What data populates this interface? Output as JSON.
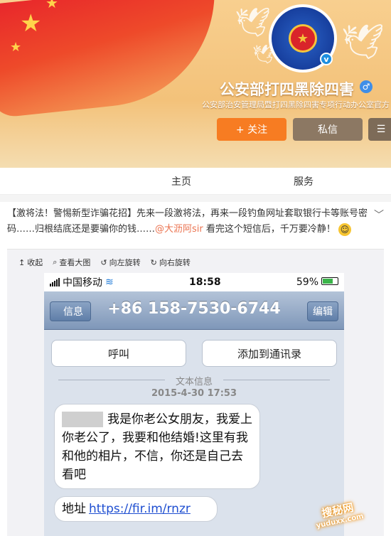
{
  "profile": {
    "name": "公安部打四黑除四害",
    "description": "公安部治安管理局暨打四黑除四害专项行动办公室官方",
    "badge_text": "★",
    "verified_mark": "v",
    "gender_mark": "♂"
  },
  "buttons": {
    "follow": "+ 关注",
    "message": "私信",
    "more_icon": "☰"
  },
  "nav": {
    "home": "主页",
    "service": "服务"
  },
  "post": {
    "text_part1": "【激将法！警惕新型诈骗花招】先来一段激将法，再来一段钓鱼网址套取银行卡等账号密码……归根结底还是要骗你的钱……",
    "mention": "@大沥阿sir",
    "text_part2": "看完这个短信后，千万要冷静！",
    "emoji": "☺",
    "expand_icon": "﹀"
  },
  "image_tools": {
    "collapse": "收起",
    "view_large": "查看大图",
    "rotate_left": "向左旋转",
    "rotate_right": "向右旋转"
  },
  "phone": {
    "carrier": "中国移动",
    "time": "18:58",
    "battery": "59%",
    "back_label": "信息",
    "number": "+86 158-7530-6744",
    "edit_label": "编辑",
    "call_label": "呼叫",
    "add_contact_label": "添加到通讯录",
    "separator": "文本信息",
    "date": "2015-4-30 17:53",
    "message1": "我是你老公女朋友，我爱上你老公了，我要和他结婚!这里有我和他的相片，不信，你还是自己去看吧",
    "message2_prefix": "地址",
    "message2_link": "https://fir.im/rnzr"
  },
  "watermark": {
    "line1": "搜秘网",
    "line2": "yuduxx.com"
  }
}
